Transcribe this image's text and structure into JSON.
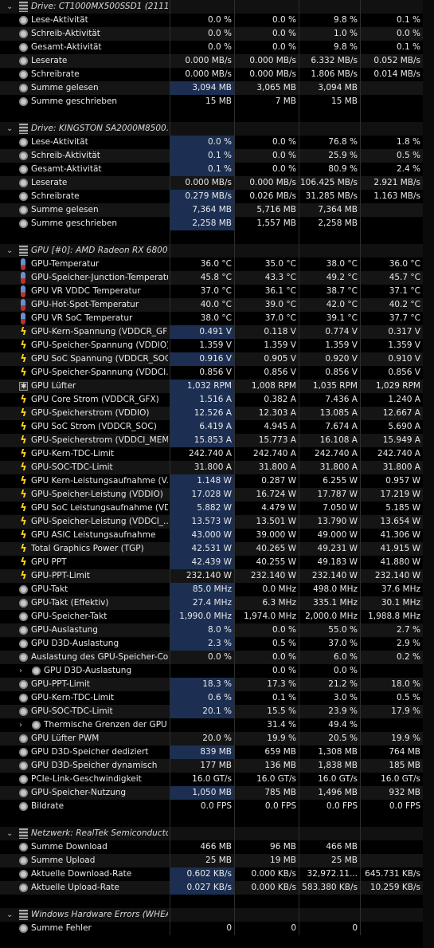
{
  "sections": [
    {
      "title": "Drive: CT1000MX500SSD1 (2111...",
      "icon": "drive-icon",
      "rows": [
        {
          "label": "Lese-Aktivität",
          "icon": "dot",
          "v": [
            "0.0 %",
            "0.0 %",
            "9.8 %",
            "0.1 %"
          ],
          "hl": []
        },
        {
          "label": "Schreib-Aktivität",
          "icon": "dot",
          "v": [
            "0.0 %",
            "0.0 %",
            "1.0 %",
            "0.0 %"
          ],
          "hl": []
        },
        {
          "label": "Gesamt-Aktivität",
          "icon": "dot",
          "v": [
            "0.0 %",
            "0.0 %",
            "9.8 %",
            "0.1 %"
          ],
          "hl": []
        },
        {
          "label": "Leserate",
          "icon": "dot",
          "v": [
            "0.000 MB/s",
            "0.000 MB/s",
            "6.332 MB/s",
            "0.052 MB/s"
          ],
          "hl": []
        },
        {
          "label": "Schreibrate",
          "icon": "dot",
          "v": [
            "0.000 MB/s",
            "0.000 MB/s",
            "1.806 MB/s",
            "0.014 MB/s"
          ],
          "hl": []
        },
        {
          "label": "Summe gelesen",
          "icon": "dot",
          "v": [
            "3,094 MB",
            "3,065 MB",
            "3,094 MB",
            ""
          ],
          "hl": [
            0
          ]
        },
        {
          "label": "Summe geschrieben",
          "icon": "dot",
          "v": [
            "15 MB",
            "7 MB",
            "15 MB",
            ""
          ],
          "hl": []
        }
      ]
    },
    {
      "title": "Drive: KINGSTON SA2000M8500...",
      "icon": "drive-icon",
      "rows": [
        {
          "label": "Lese-Aktivität",
          "icon": "dot",
          "v": [
            "0.0 %",
            "0.0 %",
            "76.8 %",
            "1.8 %"
          ],
          "hl": [
            0
          ]
        },
        {
          "label": "Schreib-Aktivität",
          "icon": "dot",
          "v": [
            "0.1 %",
            "0.0 %",
            "25.9 %",
            "0.5 %"
          ],
          "hl": [
            0
          ]
        },
        {
          "label": "Gesamt-Aktivität",
          "icon": "dot",
          "v": [
            "0.1 %",
            "0.0 %",
            "80.9 %",
            "2.4 %"
          ],
          "hl": [
            0
          ]
        },
        {
          "label": "Leserate",
          "icon": "dot",
          "v": [
            "0.000 MB/s",
            "0.000 MB/s",
            "106.425 MB/s",
            "2.921 MB/s"
          ],
          "hl": []
        },
        {
          "label": "Schreibrate",
          "icon": "dot",
          "v": [
            "0.279 MB/s",
            "0.026 MB/s",
            "31.285 MB/s",
            "1.163 MB/s"
          ],
          "hl": [
            0
          ]
        },
        {
          "label": "Summe gelesen",
          "icon": "dot",
          "v": [
            "7,364 MB",
            "5,716 MB",
            "7,364 MB",
            ""
          ],
          "hl": [
            0
          ]
        },
        {
          "label": "Summe geschrieben",
          "icon": "dot",
          "v": [
            "2,258 MB",
            "1,557 MB",
            "2,258 MB",
            ""
          ],
          "hl": [
            0
          ]
        }
      ]
    },
    {
      "title": "GPU [#0]: AMD Radeon RX 6800:",
      "icon": "gpu-icon",
      "rows": [
        {
          "label": "GPU-Temperatur",
          "icon": "therm",
          "v": [
            "36.0 °C",
            "35.0 °C",
            "38.0 °C",
            "36.0 °C"
          ],
          "hl": []
        },
        {
          "label": "GPU-Speicher-Junction-Temperatur",
          "icon": "therm",
          "v": [
            "45.8 °C",
            "43.3 °C",
            "49.2 °C",
            "45.7 °C"
          ],
          "hl": []
        },
        {
          "label": "GPU VR VDDC Temperatur",
          "icon": "therm",
          "v": [
            "37.0 °C",
            "36.1 °C",
            "38.7 °C",
            "37.1 °C"
          ],
          "hl": []
        },
        {
          "label": "GPU-Hot-Spot-Temperatur",
          "icon": "therm",
          "v": [
            "40.0 °C",
            "39.0 °C",
            "42.0 °C",
            "40.2 °C"
          ],
          "hl": []
        },
        {
          "label": "GPU VR SoC Temperatur",
          "icon": "therm",
          "v": [
            "38.0 °C",
            "37.0 °C",
            "39.1 °C",
            "37.7 °C"
          ],
          "hl": []
        },
        {
          "label": "GPU-Kern-Spannung (VDDCR_GFX)",
          "icon": "bolt",
          "v": [
            "0.491 V",
            "0.118 V",
            "0.774 V",
            "0.317 V"
          ],
          "hl": [
            0
          ]
        },
        {
          "label": "GPU-Speicher-Spannung (VDDIO)",
          "icon": "bolt",
          "v": [
            "1.359 V",
            "1.359 V",
            "1.359 V",
            "1.359 V"
          ],
          "hl": []
        },
        {
          "label": "GPU SoC Spannung (VDDCR_SOC)",
          "icon": "bolt",
          "v": [
            "0.916 V",
            "0.905 V",
            "0.920 V",
            "0.910 V"
          ],
          "hl": [
            0
          ]
        },
        {
          "label": "GPU-Speicher-Spannung (VDDCI...",
          "icon": "bolt",
          "v": [
            "0.856 V",
            "0.856 V",
            "0.856 V",
            "0.856 V"
          ],
          "hl": []
        },
        {
          "label": "GPU Lüfter",
          "icon": "fan",
          "v": [
            "1,032 RPM",
            "1,008 RPM",
            "1,035 RPM",
            "1,029 RPM"
          ],
          "hl": [
            0
          ]
        },
        {
          "label": "GPU Core Strom (VDDCR_GFX)",
          "icon": "bolt",
          "v": [
            "1.516 A",
            "0.382 A",
            "7.436 A",
            "1.240 A"
          ],
          "hl": [
            0
          ]
        },
        {
          "label": "GPU-Speicherstrom (VDDIO)",
          "icon": "bolt",
          "v": [
            "12.526 A",
            "12.303 A",
            "13.085 A",
            "12.667 A"
          ],
          "hl": [
            0
          ]
        },
        {
          "label": "GPU SoC Strom (VDDCR_SOC)",
          "icon": "bolt",
          "v": [
            "6.419 A",
            "4.945 A",
            "7.674 A",
            "5.690 A"
          ],
          "hl": [
            0
          ]
        },
        {
          "label": "GPU-Speicherstrom (VDDCI_MEM)",
          "icon": "bolt",
          "v": [
            "15.853 A",
            "15.773 A",
            "16.108 A",
            "15.949 A"
          ],
          "hl": [
            0
          ]
        },
        {
          "label": "GPU-Kern-TDC-Limit",
          "icon": "bolt",
          "v": [
            "242.740 A",
            "242.740 A",
            "242.740 A",
            "242.740 A"
          ],
          "hl": []
        },
        {
          "label": "GPU-SOC-TDC-Limit",
          "icon": "bolt",
          "v": [
            "31.800 A",
            "31.800 A",
            "31.800 A",
            "31.800 A"
          ],
          "hl": []
        },
        {
          "label": "GPU Kern-Leistungsaufnahme (V...",
          "icon": "bolt",
          "v": [
            "1.148 W",
            "0.287 W",
            "6.255 W",
            "0.957 W"
          ],
          "hl": [
            0
          ]
        },
        {
          "label": "GPU-Speicher-Leistung (VDDIO)",
          "icon": "bolt",
          "v": [
            "17.028 W",
            "16.724 W",
            "17.787 W",
            "17.219 W"
          ],
          "hl": [
            0
          ]
        },
        {
          "label": "GPU SoC Leistungsaufnahme (VD...",
          "icon": "bolt",
          "v": [
            "5.882 W",
            "4.479 W",
            "7.050 W",
            "5.185 W"
          ],
          "hl": [
            0
          ]
        },
        {
          "label": "GPU-Speicher-Leistung (VDDCI_...",
          "icon": "bolt",
          "v": [
            "13.573 W",
            "13.501 W",
            "13.790 W",
            "13.654 W"
          ],
          "hl": [
            0
          ]
        },
        {
          "label": "GPU ASIC Leistungsaufnahme",
          "icon": "bolt",
          "v": [
            "43.000 W",
            "39.000 W",
            "49.000 W",
            "41.306 W"
          ],
          "hl": [
            0
          ]
        },
        {
          "label": "Total Graphics Power (TGP)",
          "icon": "bolt",
          "v": [
            "42.531 W",
            "40.265 W",
            "49.231 W",
            "41.915 W"
          ],
          "hl": [
            0
          ]
        },
        {
          "label": "GPU PPT",
          "icon": "bolt",
          "v": [
            "42.439 W",
            "40.255 W",
            "49.183 W",
            "41.880 W"
          ],
          "hl": [
            0
          ]
        },
        {
          "label": "GPU-PPT-Limit",
          "icon": "bolt",
          "v": [
            "232.140 W",
            "232.140 W",
            "232.140 W",
            "232.140 W"
          ],
          "hl": []
        },
        {
          "label": "GPU-Takt",
          "icon": "dot",
          "v": [
            "85.0 MHz",
            "0.0 MHz",
            "498.0 MHz",
            "37.6 MHz"
          ],
          "hl": [
            0
          ]
        },
        {
          "label": "GPU-Takt (Effektiv)",
          "icon": "dot",
          "v": [
            "27.4 MHz",
            "6.3 MHz",
            "335.1 MHz",
            "30.1 MHz"
          ],
          "hl": [
            0
          ]
        },
        {
          "label": "GPU-Speicher-Takt",
          "icon": "dot",
          "v": [
            "1,990.0 MHz",
            "1,974.0 MHz",
            "2,000.0 MHz",
            "1,988.8 MHz"
          ],
          "hl": [
            0
          ]
        },
        {
          "label": "GPU-Auslastung",
          "icon": "dot",
          "v": [
            "8.0 %",
            "0.0 %",
            "55.0 %",
            "2.7 %"
          ],
          "hl": [
            0
          ]
        },
        {
          "label": "GPU D3D-Auslastung",
          "icon": "dot",
          "v": [
            "2.3 %",
            "0.5 %",
            "37.0 %",
            "2.9 %"
          ],
          "hl": [
            0
          ]
        },
        {
          "label": "Auslastung des GPU-Speicher-Co...",
          "icon": "dot",
          "v": [
            "0.0 %",
            "0.0 %",
            "6.0 %",
            "0.2 %"
          ],
          "hl": []
        },
        {
          "label": "GPU D3D-Auslastung",
          "icon": "dot",
          "sub": true,
          "v": [
            "",
            "0.0 %",
            "0.0 %",
            ""
          ],
          "hl": []
        },
        {
          "label": "GPU-PPT-Limit",
          "icon": "dot",
          "v": [
            "18.3 %",
            "17.3 %",
            "21.2 %",
            "18.0 %"
          ],
          "hl": [
            0
          ]
        },
        {
          "label": "GPU-Kern-TDC-Limit",
          "icon": "dot",
          "v": [
            "0.6 %",
            "0.1 %",
            "3.0 %",
            "0.5 %"
          ],
          "hl": [
            0
          ]
        },
        {
          "label": "GPU-SOC-TDC-Limit",
          "icon": "dot",
          "v": [
            "20.1 %",
            "15.5 %",
            "23.9 %",
            "17.9 %"
          ],
          "hl": [
            0
          ]
        },
        {
          "label": "Thermische Grenzen der GPU",
          "icon": "dot",
          "sub": true,
          "v": [
            "",
            "31.4 %",
            "49.4 %",
            ""
          ],
          "hl": []
        },
        {
          "label": "GPU Lüfter PWM",
          "icon": "dot",
          "v": [
            "20.0 %",
            "19.9 %",
            "20.5 %",
            "19.9 %"
          ],
          "hl": []
        },
        {
          "label": "GPU D3D-Speicher dediziert",
          "icon": "dot",
          "v": [
            "839 MB",
            "659 MB",
            "1,308 MB",
            "764 MB"
          ],
          "hl": [
            0
          ]
        },
        {
          "label": "GPU D3D-Speicher dynamisch",
          "icon": "dot",
          "v": [
            "177 MB",
            "136 MB",
            "1,838 MB",
            "185 MB"
          ],
          "hl": []
        },
        {
          "label": "PCIe-Link-Geschwindigkeit",
          "icon": "dot",
          "v": [
            "16.0 GT/s",
            "16.0 GT/s",
            "16.0 GT/s",
            "16.0 GT/s"
          ],
          "hl": []
        },
        {
          "label": "GPU-Speicher-Nutzung",
          "icon": "dot",
          "v": [
            "1,050 MB",
            "785 MB",
            "1,496 MB",
            "932 MB"
          ],
          "hl": [
            0
          ]
        },
        {
          "label": "Bildrate",
          "icon": "dot",
          "v": [
            "0.0 FPS",
            "0.0 FPS",
            "0.0 FPS",
            "0.0 FPS"
          ],
          "hl": []
        }
      ]
    },
    {
      "title": "Netzwerk: RealTek Semiconducto...",
      "icon": "network-icon",
      "rows": [
        {
          "label": "Summe Download",
          "icon": "dot",
          "v": [
            "466 MB",
            "96 MB",
            "466 MB",
            ""
          ],
          "hl": []
        },
        {
          "label": "Summe Upload",
          "icon": "dot",
          "v": [
            "25 MB",
            "19 MB",
            "25 MB",
            ""
          ],
          "hl": []
        },
        {
          "label": "Aktuelle Download-Rate",
          "icon": "dot",
          "v": [
            "0.602 KB/s",
            "0.000 KB/s",
            "32,972.11...",
            "645.731 KB/s"
          ],
          "hl": [
            0
          ]
        },
        {
          "label": "Aktuelle Upload-Rate",
          "icon": "dot",
          "v": [
            "0.027 KB/s",
            "0.000 KB/s",
            "583.380 KB/s",
            "10.259 KB/s"
          ],
          "hl": [
            0
          ]
        }
      ]
    },
    {
      "title": "Windows Hardware Errors (WHEA)",
      "icon": "whea-icon",
      "rows": [
        {
          "label": "Summe Fehler",
          "icon": "dot",
          "v": [
            "0",
            "0",
            "0",
            ""
          ],
          "hl": []
        }
      ]
    }
  ]
}
